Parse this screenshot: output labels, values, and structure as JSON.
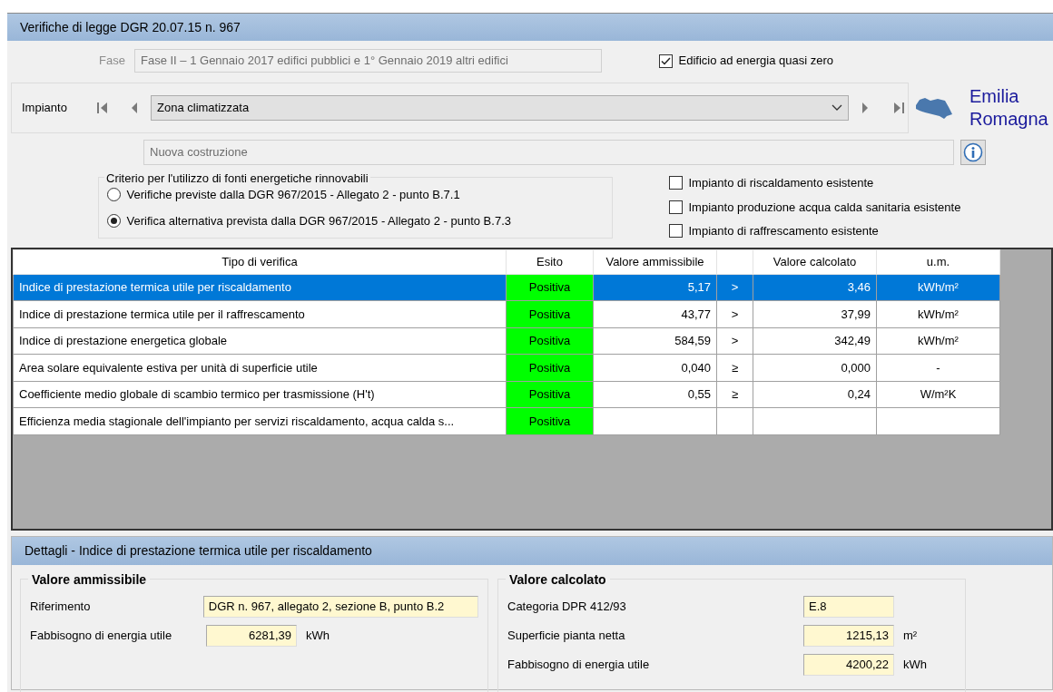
{
  "window": {
    "title": "Verifiche di legge DGR 20.07.15 n. 967"
  },
  "fase": {
    "label": "Fase",
    "value": "Fase II –  1 Gennaio 2017 edifici pubblici e 1° Gennaio 2019 altri edifici",
    "disabled": true
  },
  "nzeb": {
    "label": "Edificio ad energia quasi zero",
    "checked": true
  },
  "impianto": {
    "label": "Impianto",
    "value": "Zona climatizzata"
  },
  "region": {
    "name": "Emilia Romagna"
  },
  "intervento": {
    "value": "Nuova costruzione",
    "disabled": true
  },
  "criterio": {
    "legend": "Criterio per l'utilizzo di fonti energetiche rinnovabili",
    "options": [
      {
        "label": "Verifiche previste dalla DGR 967/2015 - Allegato 2 - punto B.7.1",
        "selected": false
      },
      {
        "label": "Verifica alternativa prevista dalla DGR 967/2015 - Allegato 2 - punto B.7.3",
        "selected": true
      }
    ]
  },
  "existing": [
    {
      "label": "Impianto di riscaldamento esistente",
      "checked": false
    },
    {
      "label": "Impianto produzione acqua calda sanitaria esistente",
      "checked": false
    },
    {
      "label": "Impianto di raffrescamento esistente",
      "checked": false
    }
  ],
  "table": {
    "columns": [
      "Tipo di verifica",
      "Esito",
      "Valore ammissibile",
      "Valore calcolato",
      "u.m."
    ],
    "rows": [
      {
        "tipo": "Indice di prestazione termica utile per riscaldamento",
        "esito": "Positiva",
        "ammissibile": "5,17",
        "operator": ">",
        "calcolato": "3,46",
        "unit": "kWh/m²",
        "selected": true
      },
      {
        "tipo": "Indice di prestazione termica utile per il raffrescamento",
        "esito": "Positiva",
        "ammissibile": "43,77",
        "operator": ">",
        "calcolato": "37,99",
        "unit": "kWh/m²",
        "selected": false
      },
      {
        "tipo": "Indice di prestazione energetica globale",
        "esito": "Positiva",
        "ammissibile": "584,59",
        "operator": ">",
        "calcolato": "342,49",
        "unit": "kWh/m²",
        "selected": false
      },
      {
        "tipo": "Area solare equivalente estiva per unità di superficie utile",
        "esito": "Positiva",
        "ammissibile": "0,040",
        "operator": "≥",
        "calcolato": "0,000",
        "unit": "-",
        "selected": false
      },
      {
        "tipo": "Coefficiente medio globale di scambio termico per trasmissione (H't)",
        "esito": "Positiva",
        "ammissibile": "0,55",
        "operator": "≥",
        "calcolato": "0,24",
        "unit": "W/m²K",
        "selected": false
      },
      {
        "tipo": "Efficienza media stagionale dell'impianto per servizi riscaldamento, acqua calda s...",
        "esito": "Positiva",
        "selected": false
      }
    ]
  },
  "details": {
    "title": "Dettagli - Indice di prestazione termica utile per riscaldamento",
    "groups": [
      {
        "legend": "Valore ammissibile",
        "fields": [
          {
            "label": "Riferimento",
            "value": "DGR n. 967, allegato 2, sezione B, punto B.2",
            "kind": "text"
          },
          {
            "label": "Fabbisogno di energia utile",
            "value": "6281,39",
            "unit": "kWh",
            "kind": "number"
          }
        ]
      },
      {
        "legend": "Valore calcolato",
        "fields": [
          {
            "label": "Categoria DPR 412/93",
            "value": "E.8",
            "kind": "text"
          },
          {
            "label": "Superficie pianta netta",
            "value": "1215,13",
            "unit": "m²",
            "kind": "number"
          },
          {
            "label": "Fabbisogno di energia utile",
            "value": "4200,22",
            "unit": "kWh",
            "kind": "number"
          }
        ]
      }
    ]
  }
}
